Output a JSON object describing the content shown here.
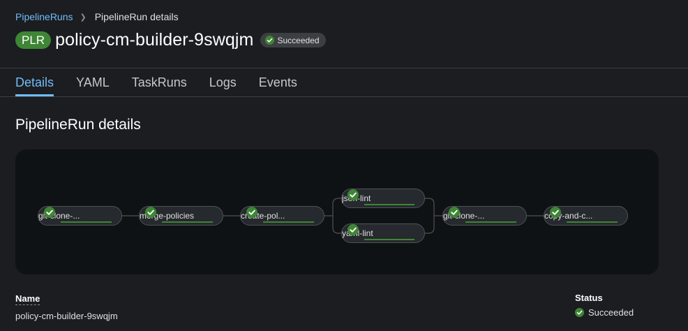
{
  "breadcrumb": {
    "parent": "PipelineRuns",
    "current": "PipelineRun details"
  },
  "header": {
    "badge": "PLR",
    "title": "policy-cm-builder-9swqjm",
    "status": "Succeeded"
  },
  "tabs": [
    "Details",
    "YAML",
    "TaskRuns",
    "Logs",
    "Events"
  ],
  "section_title": "PipelineRun details",
  "pipeline": {
    "tasks": [
      "git-clone-...",
      "merge-policies",
      "create-pol...",
      "json-lint",
      "yaml-lint",
      "git-clone-...",
      "copy-and-c..."
    ],
    "task_status": "succeeded",
    "status_color": "#3e8635"
  },
  "details": {
    "name_label": "Name",
    "name_value": "policy-cm-builder-9swqjm",
    "status_label": "Status",
    "status_value": "Succeeded"
  },
  "colors": {
    "accent": "#73bcf7",
    "success": "#3e8635",
    "background": "#1b1d21"
  }
}
